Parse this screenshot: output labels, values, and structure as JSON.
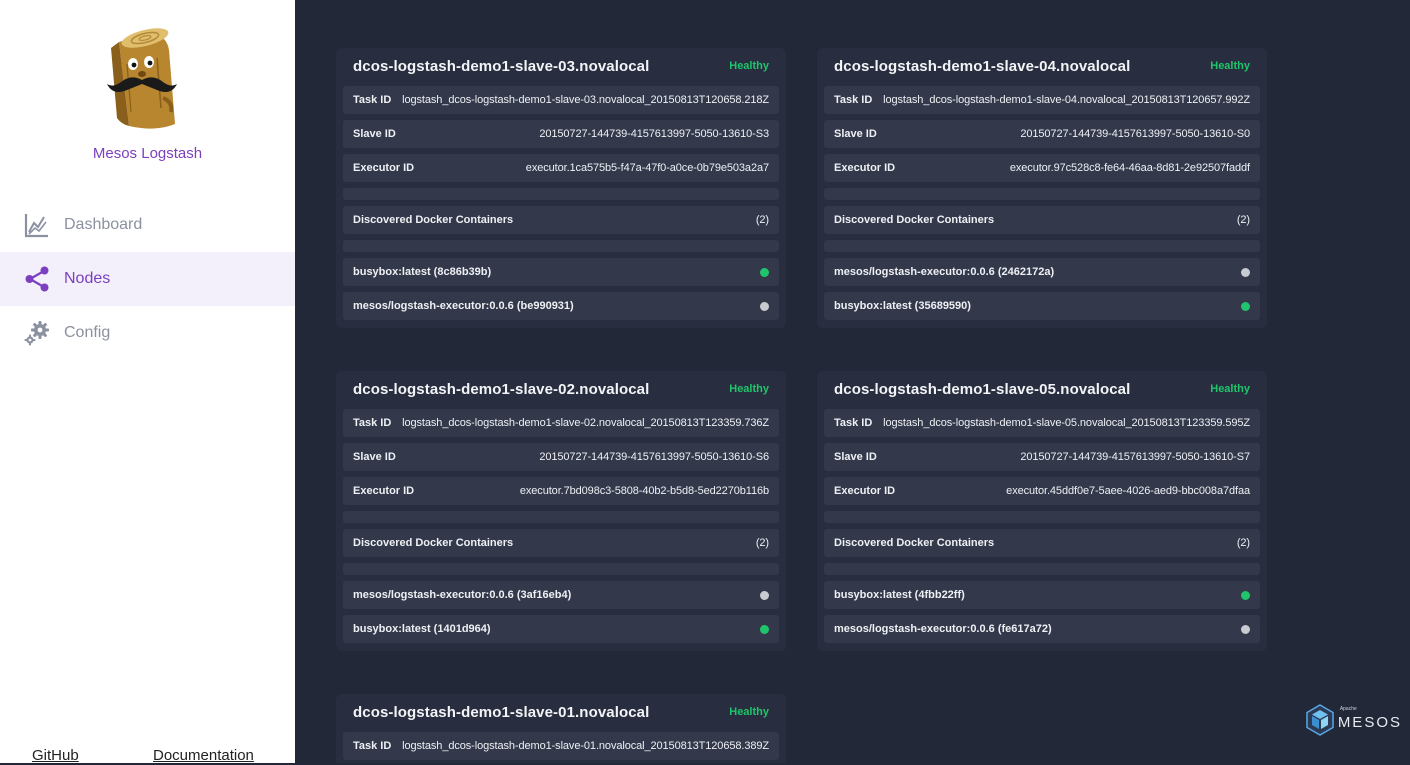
{
  "app": {
    "name": "Mesos Logstash"
  },
  "nav": {
    "items": [
      {
        "label": "Dashboard",
        "icon": "chart-line-icon",
        "active": false
      },
      {
        "label": "Nodes",
        "icon": "share-nodes-icon",
        "active": true
      },
      {
        "label": "Config",
        "icon": "gears-icon",
        "active": false
      }
    ]
  },
  "footer": {
    "github": "GitHub",
    "docs": "Documentation"
  },
  "brand": {
    "apache": "Apache",
    "mesos": "MESOS"
  },
  "colors": {
    "accent": "#7b3fbf",
    "healthy": "#1fc46b",
    "inactive": "#c9cbd0",
    "bg": "#222838",
    "card": "#282e3f"
  },
  "labels": {
    "task_id": "Task ID",
    "slave_id": "Slave ID",
    "executor_id": "Executor ID",
    "containers": "Discovered Docker Containers"
  },
  "nodes": [
    {
      "host": "dcos-logstash-demo1-slave-03.novalocal",
      "status": "Healthy",
      "task_id": "logstash_dcos-logstash-demo1-slave-03.novalocal_20150813T120658.218Z",
      "slave_id": "20150727-144739-4157613997-5050-13610-S3",
      "executor_id": "executor.1ca575b5-f47a-47f0-a0ce-0b79e503a2a7",
      "container_count": "(2)",
      "containers": [
        {
          "name": "busybox:latest (8c86b39b)",
          "state": "green"
        },
        {
          "name": "mesos/logstash-executor:0.0.6 (be990931)",
          "state": "gray"
        }
      ]
    },
    {
      "host": "dcos-logstash-demo1-slave-04.novalocal",
      "status": "Healthy",
      "task_id": "logstash_dcos-logstash-demo1-slave-04.novalocal_20150813T120657.992Z",
      "slave_id": "20150727-144739-4157613997-5050-13610-S0",
      "executor_id": "executor.97c528c8-fe64-46aa-8d81-2e92507faddf",
      "container_count": "(2)",
      "containers": [
        {
          "name": "mesos/logstash-executor:0.0.6 (2462172a)",
          "state": "gray"
        },
        {
          "name": "busybox:latest (35689590)",
          "state": "green"
        }
      ]
    },
    {
      "host": "dcos-logstash-demo1-slave-02.novalocal",
      "status": "Healthy",
      "task_id": "logstash_dcos-logstash-demo1-slave-02.novalocal_20150813T123359.736Z",
      "slave_id": "20150727-144739-4157613997-5050-13610-S6",
      "executor_id": "executor.7bd098c3-5808-40b2-b5d8-5ed2270b116b",
      "container_count": "(2)",
      "containers": [
        {
          "name": "mesos/logstash-executor:0.0.6 (3af16eb4)",
          "state": "gray"
        },
        {
          "name": "busybox:latest (1401d964)",
          "state": "green"
        }
      ]
    },
    {
      "host": "dcos-logstash-demo1-slave-05.novalocal",
      "status": "Healthy",
      "task_id": "logstash_dcos-logstash-demo1-slave-05.novalocal_20150813T123359.595Z",
      "slave_id": "20150727-144739-4157613997-5050-13610-S7",
      "executor_id": "executor.45ddf0e7-5aee-4026-aed9-bbc008a7dfaa",
      "container_count": "(2)",
      "containers": [
        {
          "name": "busybox:latest (4fbb22ff)",
          "state": "green"
        },
        {
          "name": "mesos/logstash-executor:0.0.6 (fe617a72)",
          "state": "gray"
        }
      ]
    },
    {
      "host": "dcos-logstash-demo1-slave-01.novalocal",
      "status": "Healthy",
      "task_id": "logstash_dcos-logstash-demo1-slave-01.novalocal_20150813T120658.389Z"
    }
  ]
}
